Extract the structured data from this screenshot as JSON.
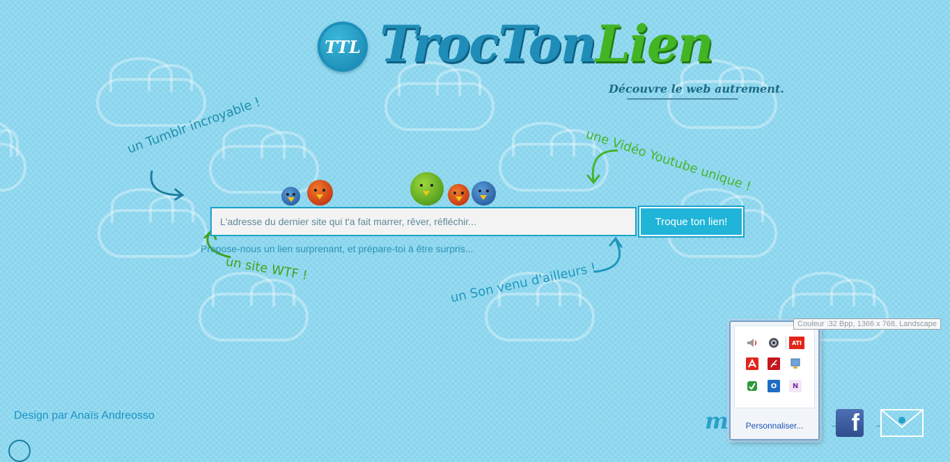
{
  "logo": {
    "badge_text": "TTL",
    "name_part1": "TrocTon",
    "name_part2": "Lien",
    "tagline": "Découvre le web autrement."
  },
  "notes": {
    "tumblr": "un Tumblr incroyable !",
    "youtube": "une Vidéo Youtube unique !",
    "wtf": "un site WTF !",
    "son": "un Son venu d'ailleurs !"
  },
  "search": {
    "placeholder": "L'adresse du dernier site qui t'a fait marrer, rêver, réfléchir...",
    "button_label": "Troque ton lien!",
    "hint": "Propose-nous un lien surprenant, et prépare-toi à être surpris..."
  },
  "footer": {
    "credit": "Design par Anaïs Andreosso",
    "m_letter": "m",
    "facebook_glyph": "f"
  },
  "tray": {
    "tooltip": "Couleur :32 Bpp, 1366 x 768, Landscape",
    "customize_label": "Personnaliser...",
    "icons": [
      "volume-icon",
      "webcam-icon",
      "ati-icon",
      "avira-icon",
      "acrobat-icon",
      "network-icon",
      "sync-icon",
      "outlook-icon",
      "onenote-icon"
    ],
    "ati_label": "ATI",
    "outlook_label": "O",
    "onenote_label": "N"
  },
  "colors": {
    "background": "#8fd8ef",
    "accent": "#1fb4d8",
    "green": "#43b525"
  }
}
